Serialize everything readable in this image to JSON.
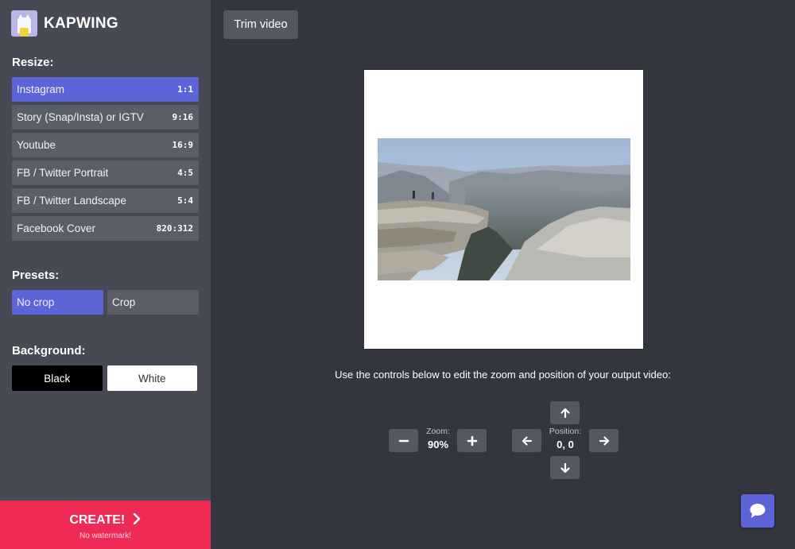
{
  "app": {
    "name": "KAPWING"
  },
  "sidebar": {
    "resize_title": "Resize:",
    "resize_options": [
      {
        "label": "Instagram",
        "ratio": "1:1",
        "active": true
      },
      {
        "label": "Story (Snap/Insta) or IGTV",
        "ratio": "9:16",
        "active": false
      },
      {
        "label": "Youtube",
        "ratio": "16:9",
        "active": false
      },
      {
        "label": "FB / Twitter Portrait",
        "ratio": "4:5",
        "active": false
      },
      {
        "label": "FB / Twitter Landscape",
        "ratio": "5:4",
        "active": false
      },
      {
        "label": "Facebook Cover",
        "ratio": "820:312",
        "active": false
      }
    ],
    "presets_title": "Presets:",
    "presets": [
      {
        "label": "No crop",
        "active": true
      },
      {
        "label": "Crop",
        "active": false
      }
    ],
    "background_title": "Background:",
    "background_options": [
      {
        "label": "Black"
      },
      {
        "label": "White"
      }
    ]
  },
  "create": {
    "label": "CREATE!",
    "sublabel": "No watermark!"
  },
  "toolbar": {
    "trim_label": "Trim video"
  },
  "editor": {
    "instructions": "Use the controls below to edit the zoom and position of your output video:",
    "zoom_label": "Zoom:",
    "zoom_value": "90%",
    "position_label": "Position:",
    "position_value": "0, 0"
  },
  "colors": {
    "accent": "#5c64d8",
    "create": "#ef2a55",
    "sidebar": "#474a54",
    "background": "#33363f"
  },
  "icons": [
    "chevron-right-icon",
    "minus-icon",
    "plus-icon",
    "arrow-up-icon",
    "arrow-down-icon",
    "arrow-left-icon",
    "arrow-right-icon",
    "chat-icon"
  ]
}
